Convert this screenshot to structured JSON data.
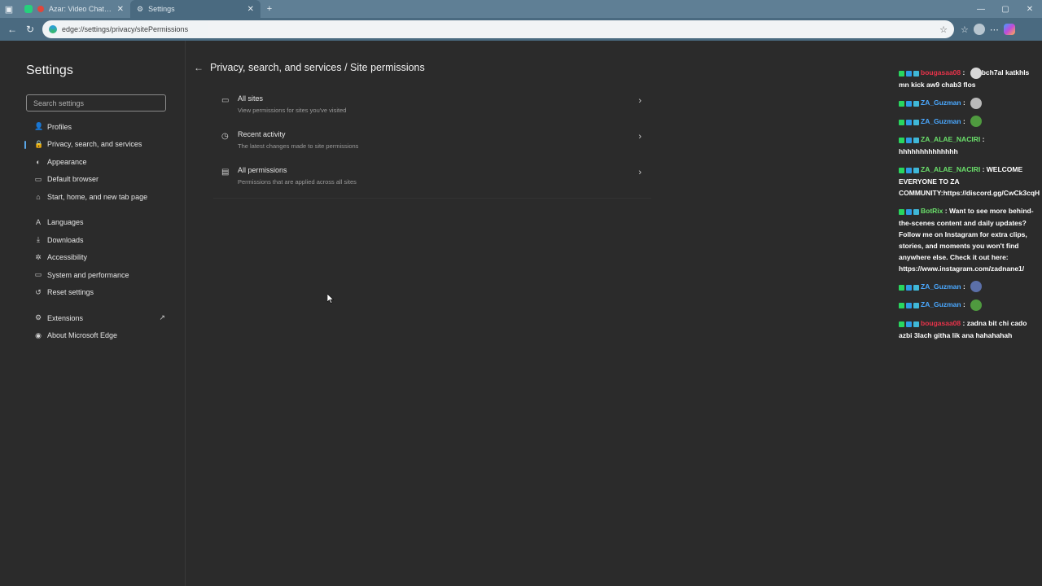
{
  "browser": {
    "tabs": [
      {
        "label": "Azar: Video Chat | Alternative",
        "active": false
      },
      {
        "label": "Settings",
        "active": true
      }
    ],
    "new_tab": "+",
    "url": "edge://settings/privacy/sitePermissions",
    "window_controls": [
      "—",
      "▢",
      "✕"
    ]
  },
  "sidebar": {
    "title": "Settings",
    "search_placeholder": "Search settings",
    "items": [
      {
        "label": "Profiles",
        "icon": "👤",
        "selected": false
      },
      {
        "label": "Privacy, search, and services",
        "icon": "🔒",
        "selected": true
      },
      {
        "label": "Appearance",
        "icon": "◐",
        "selected": false
      },
      {
        "label": "Default browser",
        "icon": "▭",
        "selected": false
      },
      {
        "label": "Start, home, and new tab page",
        "icon": "⌂",
        "selected": false
      },
      {
        "label": "Languages",
        "icon": "A",
        "selected": false
      },
      {
        "label": "Downloads",
        "icon": "⤓",
        "selected": false
      },
      {
        "label": "Accessibility",
        "icon": "✲",
        "selected": false
      },
      {
        "label": "System and performance",
        "icon": "▭",
        "selected": false
      },
      {
        "label": "Reset settings",
        "icon": "↺",
        "selected": false
      },
      {
        "label": "Extensions",
        "icon": "⚙",
        "selected": false
      },
      {
        "label": "About Microsoft Edge",
        "icon": "◉",
        "selected": false
      }
    ]
  },
  "main": {
    "title": "Privacy, search, and services / Site permissions",
    "items": [
      {
        "title": "All sites",
        "subtitle": "View permissions for sites you've visited",
        "icon": "▭"
      },
      {
        "title": "Recent activity",
        "subtitle": "The latest changes made to site permissions",
        "icon": "◷"
      },
      {
        "title": "All permissions",
        "subtitle": "Permissions that are applied across all sites",
        "icon": "▤"
      }
    ]
  },
  "chat": {
    "colors": {
      "red": "#e8334a",
      "blue": "#4aa8ff",
      "green": "#6be06b",
      "white": "#ffffff"
    },
    "messages": [
      {
        "user": "bougasaa08",
        "color": "#e8334a",
        "text": "bch7al katkhls mn kick aw9 chab3 flos",
        "emote": true,
        "emote_color": "#d8d8d8"
      },
      {
        "user": "ZA_Guzman",
        "color": "#4aa8ff",
        "text": "",
        "emote": true,
        "emote_color": "#b9b9b9"
      },
      {
        "user": "ZA_Guzman",
        "color": "#4aa8ff",
        "text": "",
        "emote": true,
        "emote_color": "#4f9a3f"
      },
      {
        "user": "ZA_ALAE_NACIRI",
        "color": "#6be06b",
        "text": "hhhhhhhhhhhhhh",
        "emote": false
      },
      {
        "user": "ZA_ALAE_NACIRI",
        "color": "#6be06b",
        "text": "WELCOME EVERYONE TO ZA COMMUNITY:https://discord.gg/CwCk3cqH",
        "emote": false
      },
      {
        "user": "BotRix",
        "color": "#6be06b",
        "text": "Want to see more behind-the-scenes content and daily updates? Follow me on Instagram for extra clips, stories, and moments you won't find anywhere else. Check it out here: https://www.instagram.com/zadnane1/",
        "emote": false
      },
      {
        "user": "ZA_Guzman",
        "color": "#4aa8ff",
        "text": "",
        "emote": true,
        "emote_color": "#5b6fa8"
      },
      {
        "user": "ZA_Guzman",
        "color": "#4aa8ff",
        "text": "",
        "emote": true,
        "emote_color": "#4f9a3f"
      },
      {
        "user": "bougasaa08",
        "color": "#e8334a",
        "text": "zadna bit chi cado azbi 3lach githa lik ana hahahahah",
        "emote": false
      }
    ]
  }
}
